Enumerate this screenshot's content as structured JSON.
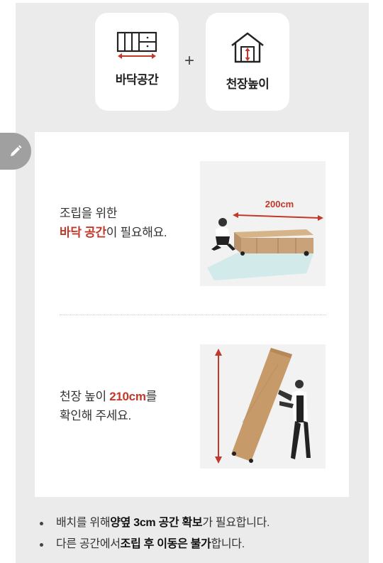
{
  "top_cards": [
    {
      "label": "바닥공간",
      "icon": "floor-width-icon"
    },
    {
      "label": "천장높이",
      "icon": "house-height-icon"
    }
  ],
  "plus": "+",
  "section1": {
    "line1": "조립을 위한",
    "highlight": "바닥 공간",
    "rest": "이 필요해요.",
    "photo_label": "200cm"
  },
  "section2": {
    "pre": "천장 높이 ",
    "highlight": "210cm",
    "post": "를",
    "line2": "확인해 주세요."
  },
  "notes": [
    {
      "pre": "배치를 위해 ",
      "bold": "양옆 3cm 공간 확보",
      "post": "가 필요합니다."
    },
    {
      "pre": "다른 공간에서 ",
      "bold": "조립 후 이동은 불가",
      "post": "합니다."
    }
  ],
  "colors": {
    "accent": "#c0392b",
    "panel": "#ebebeb",
    "card": "#ffffff"
  }
}
